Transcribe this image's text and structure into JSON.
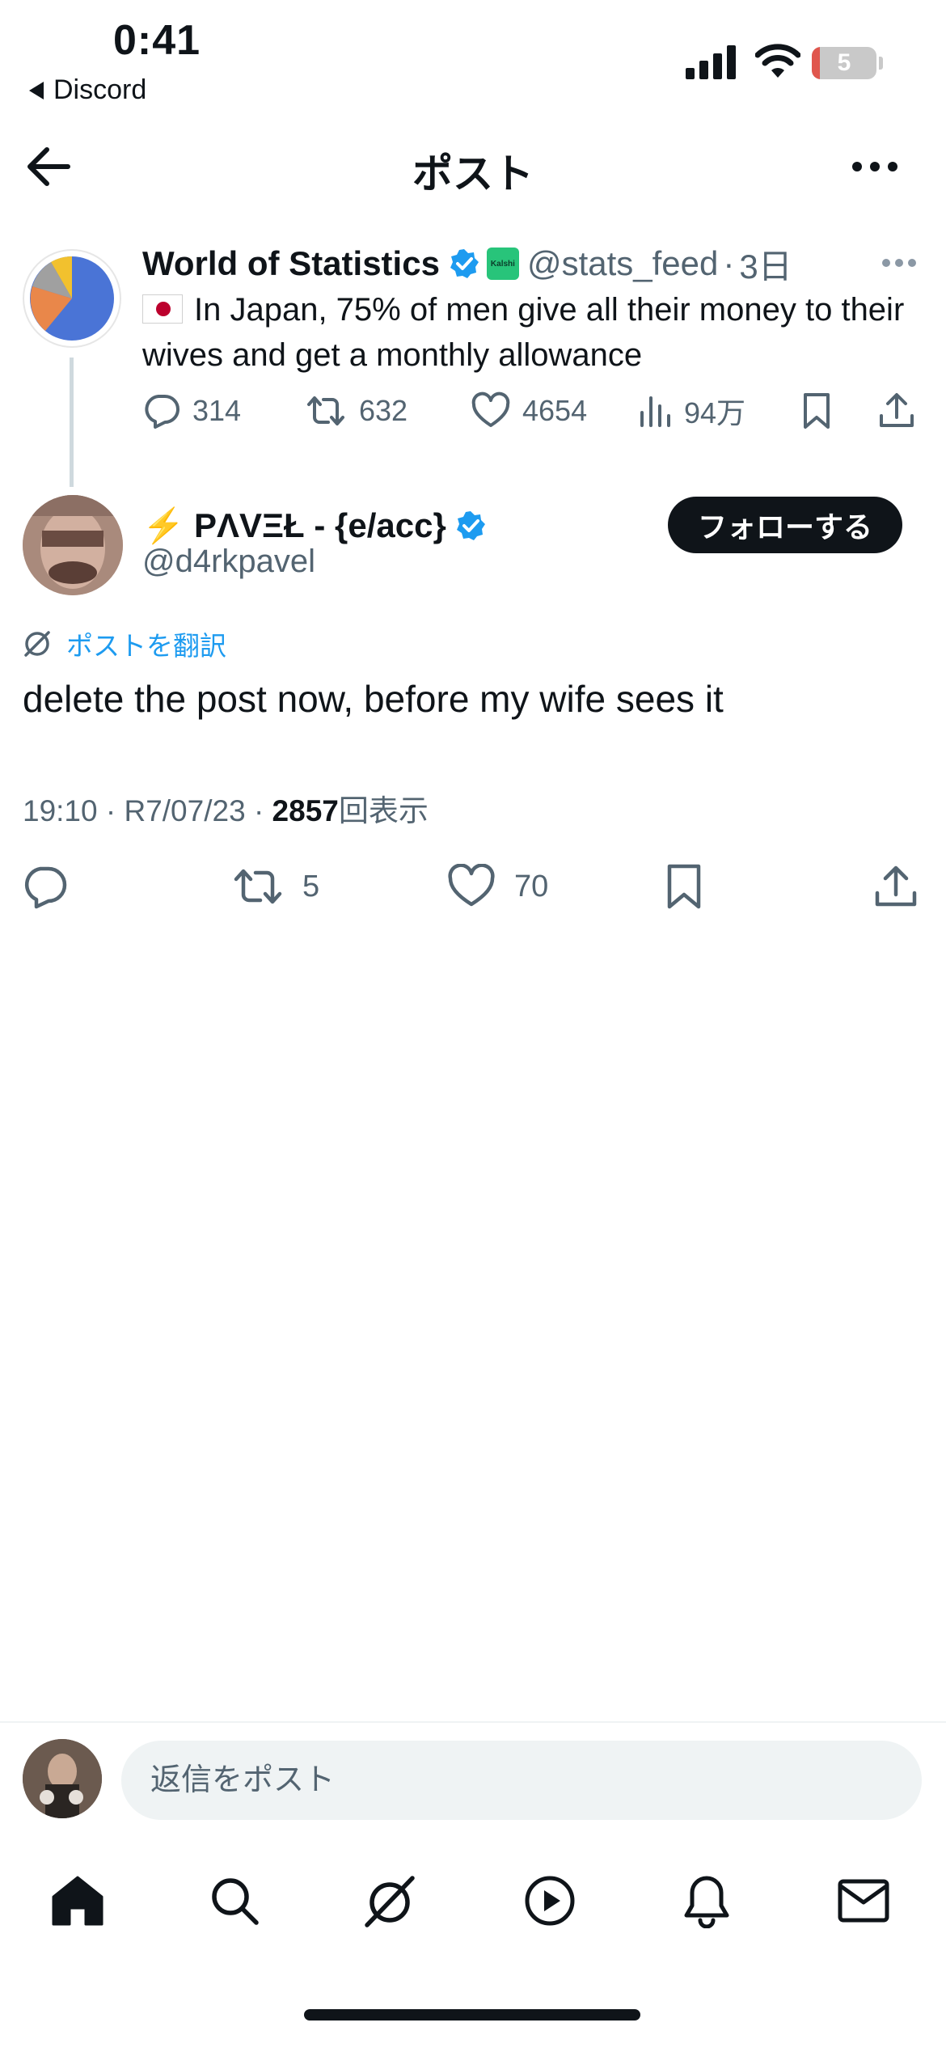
{
  "status_bar": {
    "time": "0:41",
    "back_app": "Discord",
    "battery_level": "5",
    "battery_color": "#e0564d"
  },
  "header": {
    "back_icon": "arrow-left-icon",
    "title": "ポスト",
    "more_icon": "more-horizontal-icon"
  },
  "parent_post": {
    "author_name": "World of Statistics",
    "verified": true,
    "affiliate_badge": "Kalshi",
    "handle": "@stats_feed",
    "separator": "·",
    "age": "3日",
    "flag": "🇯🇵",
    "text": "In Japan, 75% of men give all their money to their wives and get a monthly allowance",
    "replies": "314",
    "reposts": "632",
    "likes": "4654",
    "views": "94万"
  },
  "main_post": {
    "author_name": "⚡️ PΛVΞŁ - {e/acc}",
    "verified": true,
    "handle": "@d4rkpavel",
    "follow_label": "フォローする",
    "translate_label": "ポストを翻訳",
    "text": "delete the post now, before my wife sees it",
    "time": "19:10",
    "date": "R7/07/23",
    "views_count": "2857",
    "views_label": "回表示",
    "dot": "·",
    "reposts": "5",
    "likes": "70"
  },
  "reply": {
    "placeholder": "返信をポスト"
  },
  "tab_bar": {
    "items": [
      "home-icon",
      "search-icon",
      "grok-icon",
      "video-icon",
      "notifications-icon",
      "messages-icon"
    ]
  },
  "colors": {
    "accent": "#1d9bf0",
    "verified": "#1d9bf0",
    "text_primary": "#0f1419",
    "text_secondary": "#536471"
  }
}
